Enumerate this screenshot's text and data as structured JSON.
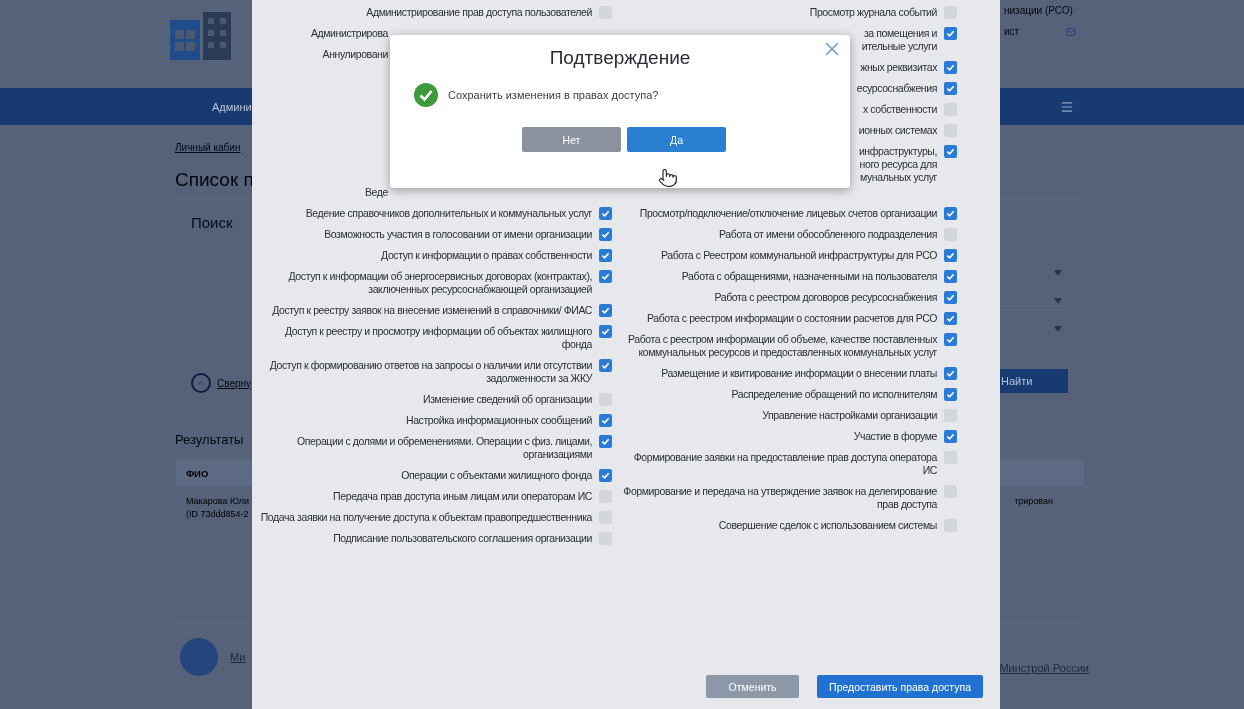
{
  "page": {
    "header": {
      "org_fragment": "низации (РСО)",
      "user_fragment": "ист"
    },
    "nav": {
      "item_fragment": "Админи"
    },
    "breadcrumb": "Личный кабин",
    "title": "Список п",
    "search": {
      "title": "Поиск",
      "collapse": "Сверну",
      "find_button": "Найти"
    },
    "results": {
      "title": "Результаты",
      "column_1": "ФИО",
      "row_name": "Макарова Юли",
      "row_id": "(ID 73ddd854-2",
      "row_status": "трирован"
    },
    "footer": {
      "link_left": "Ми",
      "link_right": "Минстрой России"
    }
  },
  "permissions_dialog": {
    "upper_left": [
      {
        "kind": "full",
        "text": "Администрирование прав доступа пользователей",
        "checked": false
      },
      {
        "kind": "cut_start",
        "text": "Администрирова"
      },
      {
        "kind": "cut_start",
        "text": "Аннулировани"
      },
      {
        "kind": "cut_start",
        "text": "Веде"
      }
    ],
    "upper_right": [
      {
        "kind": "full",
        "text": "Просмотр журнала событий",
        "checked": false
      },
      {
        "kind": "cut_end",
        "fragments": [
          "за помещения и",
          "ительные услуги"
        ],
        "checked": true
      },
      {
        "kind": "cut_end",
        "fragments": [
          "жных реквизитах"
        ],
        "checked": true
      },
      {
        "kind": "cut_end",
        "fragments": [
          "есурсоснабжения"
        ],
        "checked": true
      },
      {
        "kind": "cut_end",
        "fragments": [
          "х собственности"
        ],
        "checked": false
      },
      {
        "kind": "cut_end",
        "fragments": [
          "ионных системах"
        ],
        "checked": false
      },
      {
        "kind": "cut_end",
        "fragments": [
          "инфраструктуры,",
          "ного ресурса для",
          "мунальных услуг"
        ],
        "checked": true
      }
    ],
    "left": [
      {
        "text": "Ведение справочников дополнительных и коммунальных услуг",
        "checked": true
      },
      {
        "text": "Возможность участия в голосовании от имени организации",
        "checked": true
      },
      {
        "text": "Доступ к информации о правах собственности",
        "checked": true
      },
      {
        "text": "Доступ к информации об энергосервисных договорах (контрактах), заключенных ресурсоснабжающей организацией",
        "checked": true
      },
      {
        "text": "Доступ к реестру заявок на внесение изменений в справочники/ ФИАС",
        "checked": true
      },
      {
        "text": "Доступ к реестру и просмотру информации об объектах жилищного фонда",
        "checked": true
      },
      {
        "text": "Доступ к формированию ответов на запросы о наличии или отсутствии задолженности за ЖКУ",
        "checked": true
      },
      {
        "text": "Изменение сведений об организации",
        "checked": false
      },
      {
        "text": "Настройка информационных сообщений",
        "checked": true
      },
      {
        "text": "Операции с долями и обременениями. Операции с физ. лицами, организациями",
        "checked": true
      },
      {
        "text": "Операции с объектами жилищного фонда",
        "checked": true
      },
      {
        "text": "Передача прав доступа иным лицам или операторам ИС",
        "checked": false
      },
      {
        "text": "Подача заявки на получение доступа к объектам правопредшественника",
        "checked": false
      },
      {
        "text": "Подписание пользовательского соглашения организации",
        "checked": false
      }
    ],
    "right": [
      {
        "text": "Просмотр/подключение/отключение лицевых счетов организации",
        "checked": true
      },
      {
        "text": "Работа от имени обособленного подразделения",
        "checked": false
      },
      {
        "text": "Работа с Реестром коммунальной инфраструктуры для РСО",
        "checked": true
      },
      {
        "text": "Работа с обращениями, назначенными на пользователя",
        "checked": true
      },
      {
        "text": "Работа с реестром договоров ресурсоснабжения",
        "checked": true
      },
      {
        "text": "Работа с реестром информации о состоянии расчетов для РСО",
        "checked": true
      },
      {
        "text": "Работа с реестром информации об объеме, качестве поставленных коммунальных ресурсов и предоставленных коммунальных услуг",
        "checked": true
      },
      {
        "text": "Размещение и квитирование информации о внесении платы",
        "checked": true
      },
      {
        "text": "Распределение обращений по исполнителям",
        "checked": true
      },
      {
        "text": "Управление настройками организации",
        "checked": false
      },
      {
        "text": "Участие в форуме",
        "checked": true
      },
      {
        "text": "Формирование заявки на предоставление прав доступа оператора ИС",
        "checked": false
      },
      {
        "text": "Формирование и передача на утверждение заявок на делегирование прав доступа",
        "checked": false
      },
      {
        "text": "Совершение сделок с использованием системы",
        "checked": false
      }
    ],
    "buttons": [
      {
        "label": "Отменить",
        "kind": "secondary"
      },
      {
        "label": "Предоставить права доступа",
        "kind": "primary"
      }
    ]
  },
  "confirm_dialog": {
    "title": "Подтверждение",
    "message": "Сохранить изменения в правах доступа?",
    "buttons": [
      {
        "label": "Нет",
        "kind": "secondary"
      },
      {
        "label": "Да",
        "kind": "primary"
      }
    ]
  }
}
